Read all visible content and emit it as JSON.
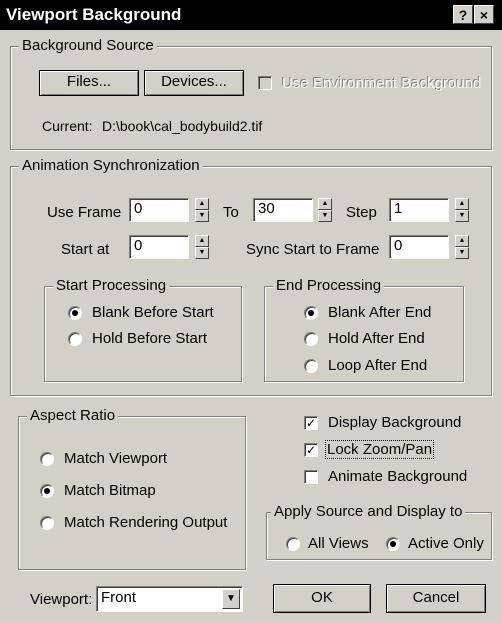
{
  "window": {
    "title": "Viewport Background",
    "help_label": "?",
    "close_label": "×"
  },
  "background_source": {
    "legend": "Background Source",
    "files_label": "Files...",
    "devices_label": "Devices...",
    "use_env_label": "Use Environment Background",
    "use_env_checked": false,
    "current_label": "Current:",
    "current_path": "D:\\book\\cal_bodybuild2.tif"
  },
  "animation_sync": {
    "legend": "Animation Synchronization",
    "use_frame_label": "Use Frame",
    "use_frame_value": "0",
    "to_label": "To",
    "to_value": "30",
    "step_label": "Step",
    "step_value": "1",
    "start_at_label": "Start at",
    "start_at_value": "0",
    "sync_start_label": "Sync Start to Frame",
    "sync_start_value": "0",
    "start_processing": {
      "legend": "Start Processing",
      "options": [
        "Blank Before Start",
        "Hold Before Start"
      ],
      "selected": 0
    },
    "end_processing": {
      "legend": "End Processing",
      "options": [
        "Blank After End",
        "Hold After End",
        "Loop After End"
      ],
      "selected": 0
    }
  },
  "aspect_ratio": {
    "legend": "Aspect Ratio",
    "options": [
      "Match Viewport",
      "Match Bitmap",
      "Match Rendering Output"
    ],
    "selected": 1
  },
  "display_options": {
    "display_background_label": "Display Background",
    "display_background_checked": true,
    "lock_zoom_label": "Lock Zoom/Pan",
    "lock_zoom_checked": true,
    "animate_background_label": "Animate Background",
    "animate_background_checked": false
  },
  "apply_to": {
    "legend": "Apply Source and Display to",
    "options": [
      "All Views",
      "Active Only"
    ],
    "selected": 1
  },
  "viewport": {
    "label": "Viewport:",
    "value": "Front"
  },
  "buttons": {
    "ok_label": "OK",
    "cancel_label": "Cancel"
  },
  "icons": {
    "spinner": "spinner-arrows-icon",
    "dropdown": "dropdown-arrow-icon",
    "check": "check-mark-icon",
    "radio": "radio-dot-icon"
  }
}
